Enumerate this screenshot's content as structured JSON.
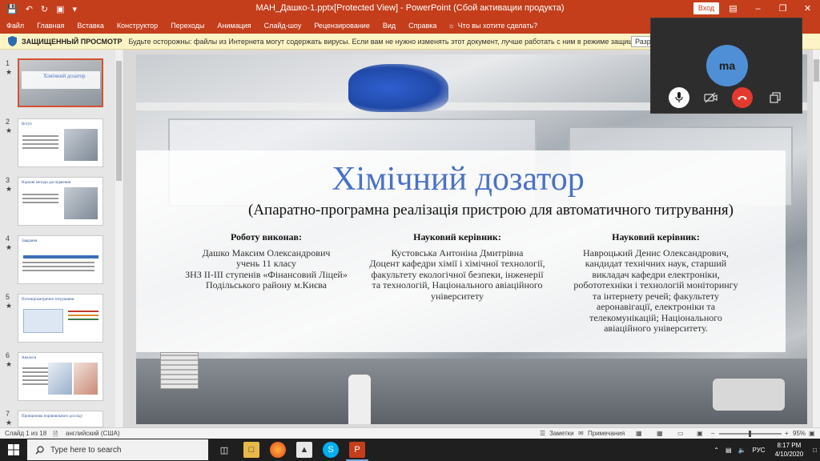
{
  "titlebar": {
    "title": "МАН_Дашко-1.pptx[Protected View] - PowerPoint (Сбой активации продукта)",
    "signin": "Вход",
    "colors": {
      "accent": "#c43e1c"
    }
  },
  "ribbon": {
    "tabs": [
      "Файл",
      "Главная",
      "Вставка",
      "Конструктор",
      "Переходы",
      "Анимация",
      "Слайд-шоу",
      "Рецензирование",
      "Вид",
      "Справка"
    ],
    "tell_me": "Что вы хотите сделать?"
  },
  "protected_view": {
    "title": "ЗАЩИЩЕННЫЙ ПРОСМОТР",
    "message": "Будьте осторожны: файлы из Интернета могут содержать вирусы. Если вам не нужно изменять этот документ, лучше работать с ним в режиме защищенного просмотра.",
    "button": "Разрешить редактирование"
  },
  "thumbnails": [
    {
      "num": "1",
      "star": "★",
      "title": "Хімічний дозатор"
    },
    {
      "num": "2",
      "star": "★",
      "title": "Вступ"
    },
    {
      "num": "3",
      "star": "★",
      "title": "Наукові методи дослідження"
    },
    {
      "num": "4",
      "star": "★",
      "title": "Завдання"
    },
    {
      "num": "5",
      "star": "★",
      "title": "Потенціометричне титрування"
    },
    {
      "num": "6",
      "star": "★",
      "title": "Аналоги"
    },
    {
      "num": "7",
      "star": "★",
      "title": "Принципова порівняльного досліду"
    }
  ],
  "slide": {
    "title": "Хімічний дозатор",
    "subtitle": "(Апаратно-програмна реалізація пристрою для автоматичного титрування)",
    "col1": {
      "heading": "Роботу виконав:",
      "lines": [
        "Дашко Максим Олександрович",
        "учень 11 класу",
        "ЗНЗ ІІ-ІІІ ступенів «Фінансовий Ліцей»",
        "Подільського району м.Києва"
      ]
    },
    "col2": {
      "heading": "Науковий керівник:",
      "lines": [
        "Кустовська Антоніна Дмитрівна",
        "Доцент кафедри хімії і хімічної технології,",
        "факультету екологічної безпеки, інженерії",
        "та технологій, Національного авіаційного",
        "університету"
      ]
    },
    "col3": {
      "heading": "Науковий керівник:",
      "lines": [
        "Навроцький Денис Олександрович,",
        "кандидат технічних наук, старший",
        "викладач кафедри електроніки,",
        "робототехніки і технологій моніторингу",
        "та інтернету речей; факультету",
        "аеронавігації, електроніки та",
        "телекомунікацій; Національного",
        "авіаційного університету."
      ]
    }
  },
  "call": {
    "avatar_initials": "ma",
    "colors": {
      "avatar": "#4f8fd6",
      "end_call": "#e23a2e"
    }
  },
  "statusbar": {
    "slide_of": "Слайд 1 из 18",
    "language": "английский (США)",
    "notes": "Заметки",
    "comments": "Примечания",
    "zoom": "95%"
  },
  "taskbar": {
    "search_placeholder": "Type here to search",
    "tray_lang": "РУС",
    "time": "8:17 PM",
    "date": "4/10/2020"
  }
}
